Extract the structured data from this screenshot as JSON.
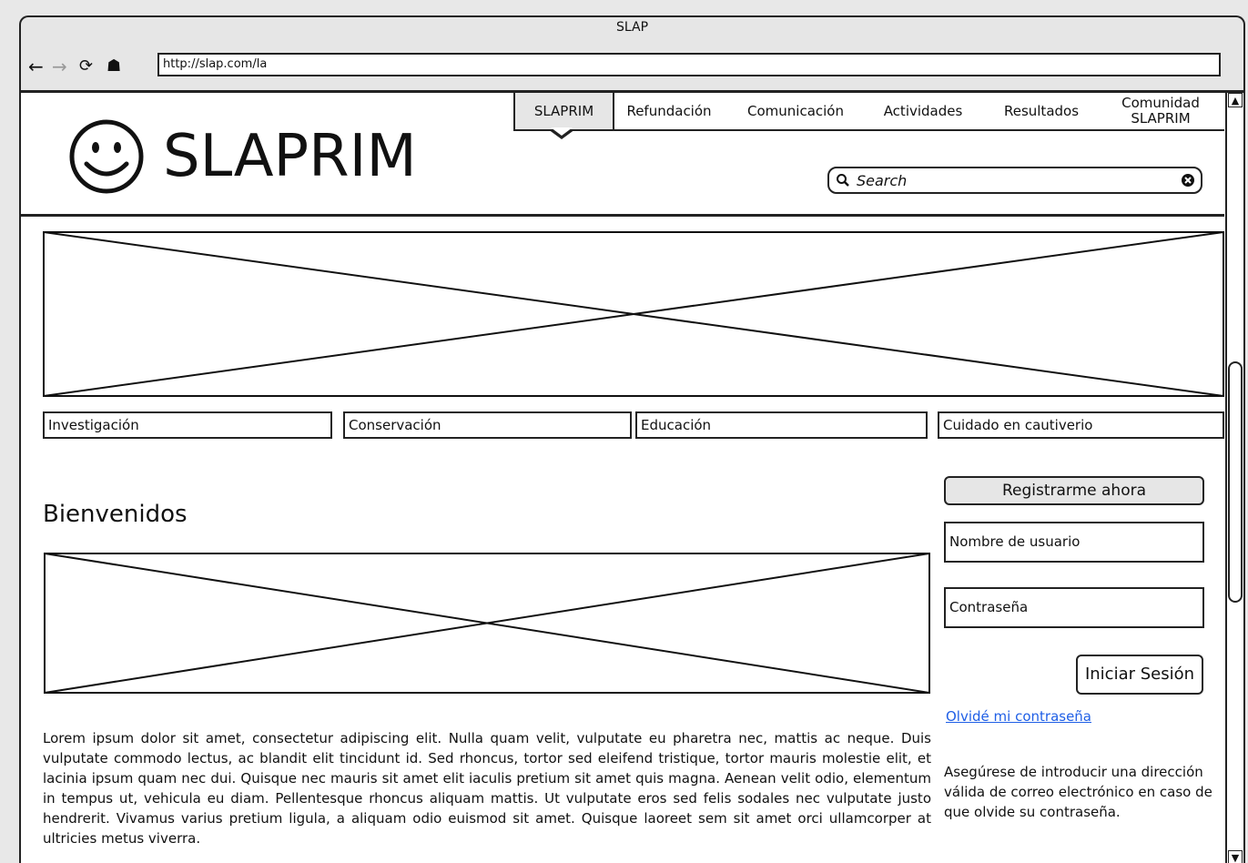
{
  "window": {
    "title": "SLAP"
  },
  "browser": {
    "url": "http://slap.com/la"
  },
  "header": {
    "logo_text": "SLAPRIM",
    "tabs": [
      {
        "label": "SLAPRIM"
      },
      {
        "label": "Refundación"
      },
      {
        "label": "Comunicación"
      },
      {
        "label": "Actividades"
      },
      {
        "label": "Resultados"
      },
      {
        "label": "Comunidad SLAPRIM"
      }
    ],
    "active_tab": "SLAPRIM",
    "search_placeholder": "Search"
  },
  "categories": [
    {
      "label": "Investigación"
    },
    {
      "label": "Conservación"
    },
    {
      "label": "Educación"
    },
    {
      "label": "Cuidado en cautiverio"
    }
  ],
  "main": {
    "heading": "Bienvenidos",
    "body": "Lorem ipsum dolor sit amet, consectetur adipiscing elit. Nulla quam velit, vulputate eu pharetra nec, mattis ac neque. Duis vulputate commodo lectus, ac blandit elit tincidunt id. Sed rhoncus, tortor sed eleifend tristique, tortor mauris molestie elit, et lacinia ipsum quam nec dui. Quisque nec mauris sit amet elit iaculis pretium sit amet quis magna. Aenean velit odio, elementum in tempus ut, vehicula eu diam. Pellentesque rhoncus aliquam mattis. Ut vulputate eros sed felis sodales nec vulputate justo hendrerit. Vivamus varius pretium ligula, a aliquam odio euismod sit amet. Quisque laoreet sem sit amet orci ullamcorper at ultricies metus viverra."
  },
  "login": {
    "register_label": "Registrarme ahora",
    "username_placeholder": "Nombre de usuario",
    "password_placeholder": "Contraseña",
    "login_label": "Iniciar Sesión",
    "forgot_link": "Olvidé mi contraseña",
    "note": "Asegúrese de introducir una dirección válida de correo electrónico en caso de que olvide su contraseña."
  }
}
